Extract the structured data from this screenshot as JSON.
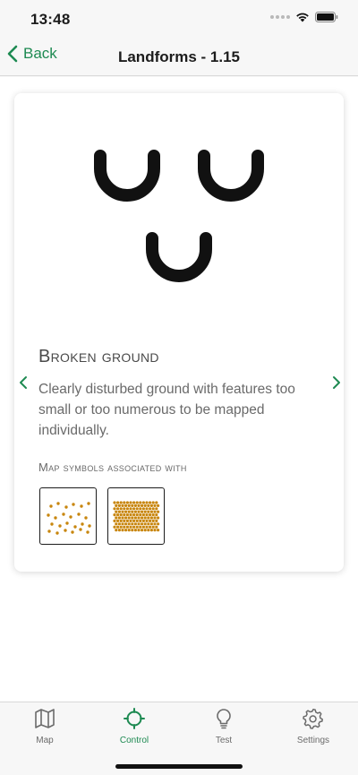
{
  "status_bar": {
    "time": "13:48"
  },
  "nav": {
    "back_label": "Back",
    "title": "Landforms - 1.15"
  },
  "card": {
    "hero_icon": "broken-ground-symbol",
    "term_title": "Broken ground",
    "description": "Clearly disturbed ground with features too small or too numerous to be mapped individually.",
    "associated_label": "Map symbols associated with",
    "symbols": [
      "broken-ground-sparse-dots",
      "broken-ground-dense-dots"
    ]
  },
  "tabs": [
    {
      "label": "Map",
      "icon": "map-icon"
    },
    {
      "label": "Control",
      "icon": "control-crosshair-icon",
      "active": true
    },
    {
      "label": "Test",
      "icon": "lightbulb-icon"
    },
    {
      "label": "Settings",
      "icon": "gear-icon"
    }
  ],
  "colors": {
    "accent": "#1e8a52",
    "symbol_orange": "#c8860e"
  }
}
